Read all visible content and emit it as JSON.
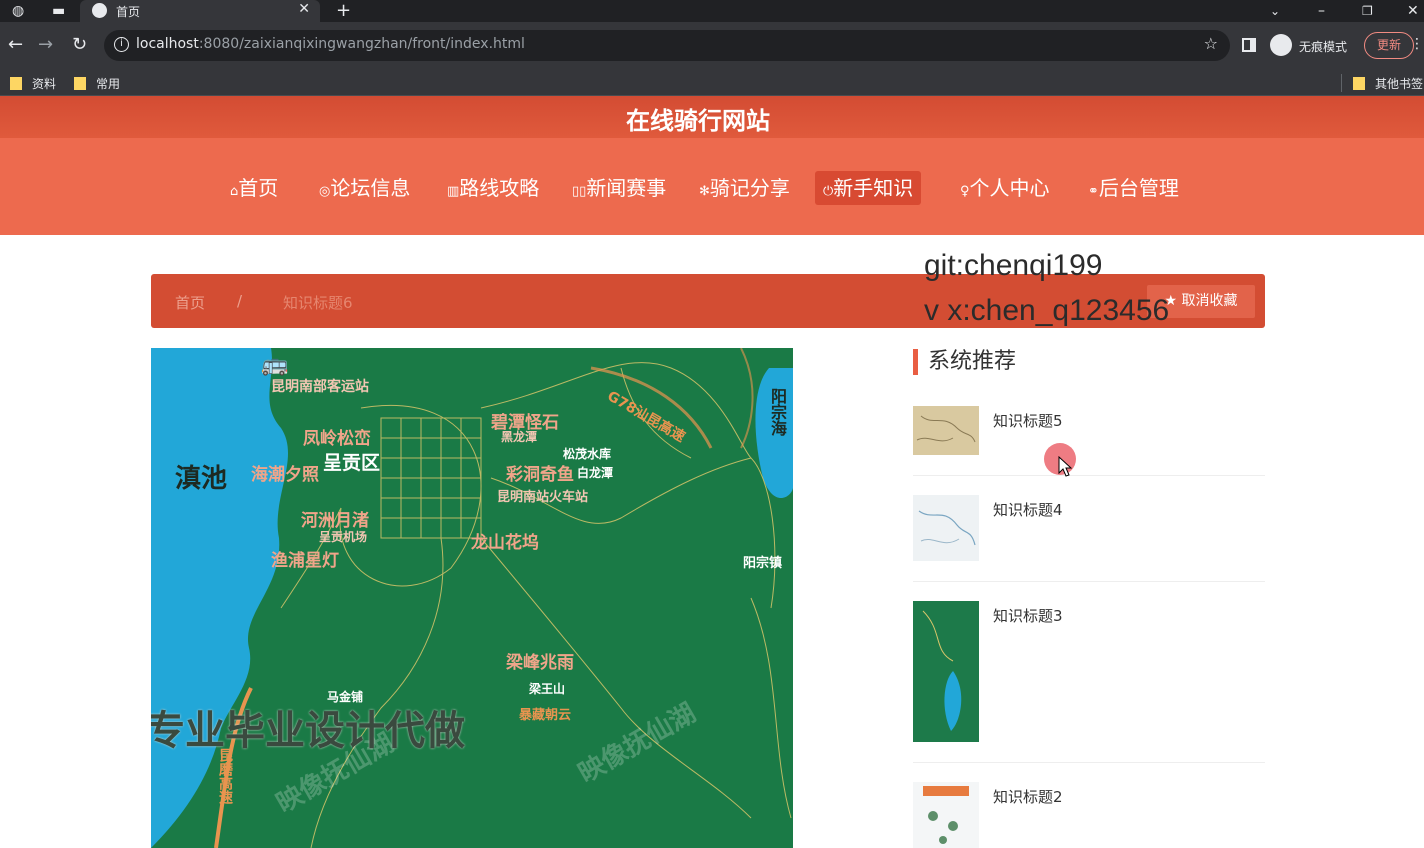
{
  "browser": {
    "tab_title": "首页",
    "url_host": "localhost",
    "url_rest": ":8080/zaixianqixingwangzhan/front/index.html",
    "incognito_label": "无痕模式",
    "update_label": "更新",
    "bookmarks": [
      "资料",
      "常用"
    ],
    "other_bookmarks": "其他书签"
  },
  "site": {
    "title": "在线骑行网站",
    "nav": [
      {
        "icon": "⌂",
        "label": "首页"
      },
      {
        "icon": "◎",
        "label": "论坛信息"
      },
      {
        "icon": "▥",
        "label": "路线攻略"
      },
      {
        "icon": "▯▯",
        "label": "新闻赛事"
      },
      {
        "icon": "✻",
        "label": "骑记分享"
      },
      {
        "icon": "⏻",
        "label": "新手知识"
      },
      {
        "icon": "♀",
        "label": "个人中心"
      },
      {
        "icon": "⚭",
        "label": "后台管理"
      }
    ],
    "active_nav": "新手知识"
  },
  "breadcrumb": {
    "home": "首页",
    "separator": "/",
    "current": "知识标题6"
  },
  "favorite_button": "★ 取消收藏",
  "overlay": {
    "line1": "git:chenqi199",
    "line2": "v x:chen_q123456"
  },
  "map": {
    "labels": {
      "dianchi": "滇池",
      "bus_station": "昆明南部客运站",
      "fengling": "凤岭松峦",
      "chenggong": "呈贡区",
      "haichao": "海潮夕照",
      "bitan": "碧潭怪石",
      "heilongtan": "黑龙潭",
      "songmao": "松茂水库",
      "caidong": "彩洞奇鱼",
      "bailongtan": "白龙潭",
      "railway": "昆明南站火车站",
      "hezhou": "河洲月渚",
      "airport": "呈贡机场",
      "yupu": "渔浦星灯",
      "longshan": "龙山花坞",
      "highway": "G78汕昆高速",
      "yangzonghai": "阳宗海",
      "yangzongzhen": "阳宗镇",
      "liangfeng": "梁峰兆雨",
      "liangwangshan": "梁王山",
      "mochuan": "暴藏朝云",
      "majie": "马金铺",
      "kunmo": "昆磨高速"
    },
    "watermark": "专业毕业设计代做",
    "faint_watermark": "映像抚仙湖"
  },
  "recommend": {
    "title": "系统推荐",
    "items": [
      "知识标题5",
      "知识标题4",
      "知识标题3",
      "知识标题2"
    ]
  },
  "colors": {
    "brand_dark": "#d34c33",
    "brand": "#ed6a4e",
    "map_green": "#1a7a46",
    "lake_blue": "#22a7d8"
  }
}
